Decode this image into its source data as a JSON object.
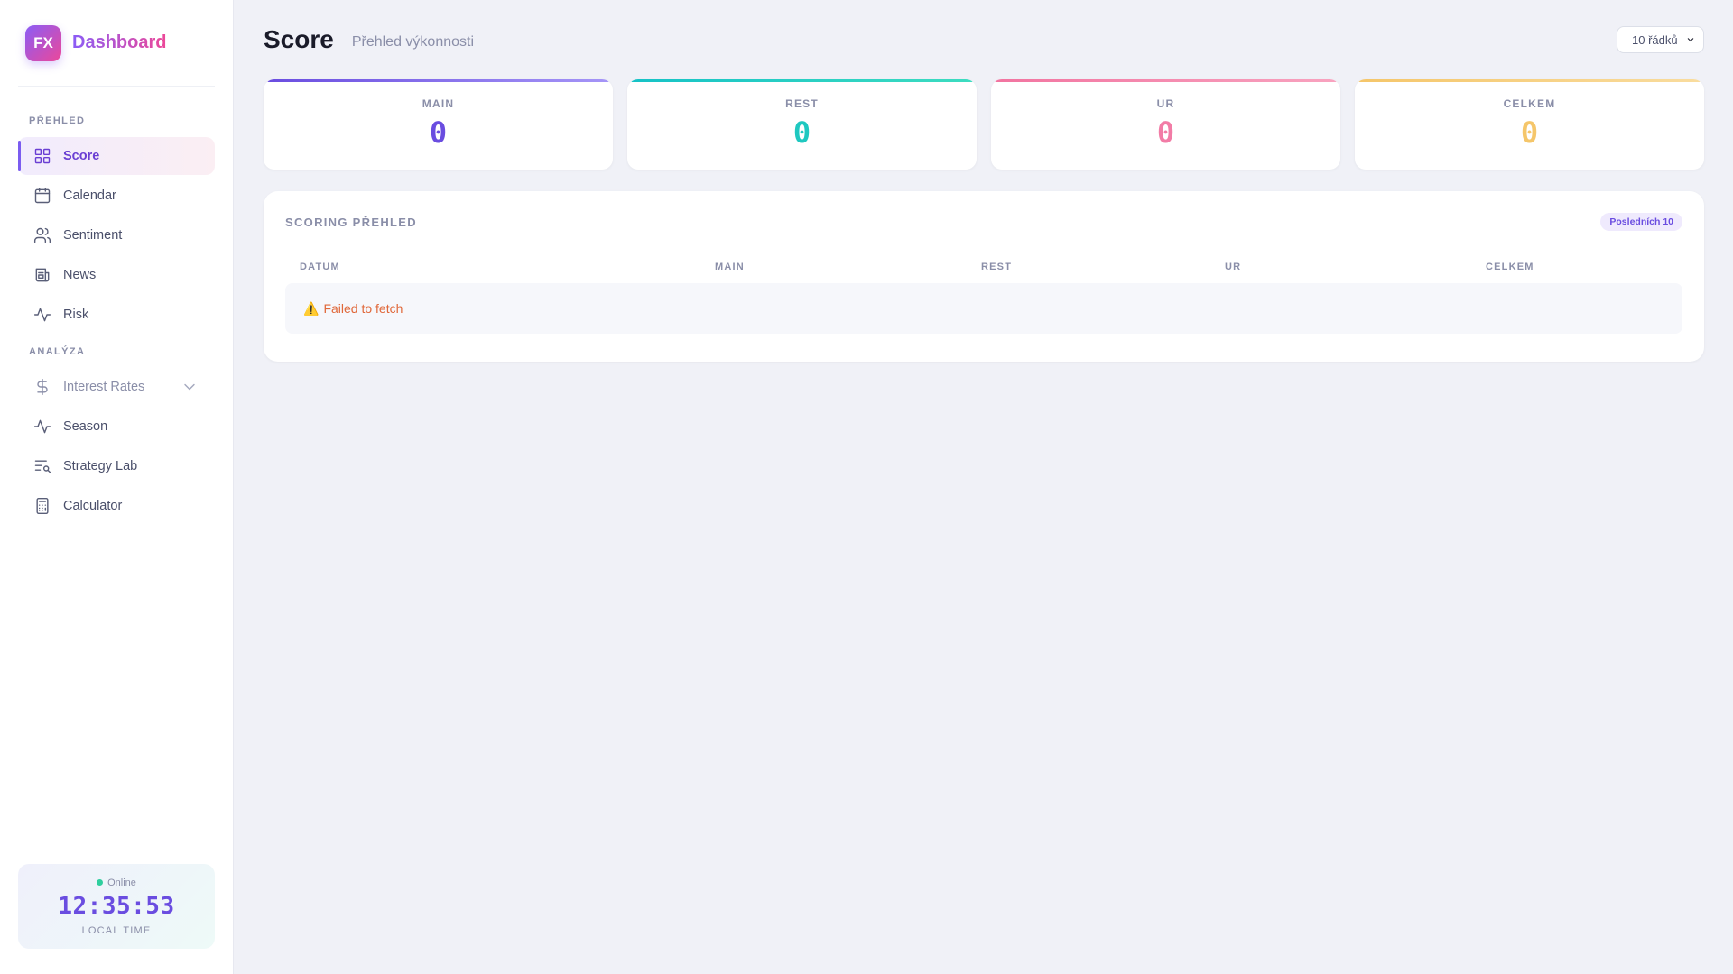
{
  "brand": {
    "logo": "FX",
    "title": "Dashboard"
  },
  "sidebar": {
    "section_overview": "PŘEHLED",
    "section_analysis": "ANALÝZA",
    "items": [
      {
        "label": "Score",
        "icon": "grid-icon",
        "active": true
      },
      {
        "label": "Calendar",
        "icon": "calendar-icon"
      },
      {
        "label": "Sentiment",
        "icon": "users-icon"
      },
      {
        "label": "News",
        "icon": "newspaper-icon"
      },
      {
        "label": "Risk",
        "icon": "activity-icon"
      }
    ],
    "analysis_items": [
      {
        "label": "Interest Rates",
        "icon": "dollar-icon",
        "expandable": true
      },
      {
        "label": "Season",
        "icon": "activity-icon"
      },
      {
        "label": "Strategy Lab",
        "icon": "list-search-icon"
      },
      {
        "label": "Calculator",
        "icon": "calculator-icon"
      }
    ]
  },
  "clock": {
    "status": "Online",
    "time": "12:35:53",
    "label": "LOCAL TIME"
  },
  "header": {
    "title": "Score",
    "subtitle": "Přehled výkonnosti",
    "rows_select": "10 řádků"
  },
  "cards": [
    {
      "label": "MAIN",
      "value": "0",
      "color": "#6a4de0",
      "bar": "#8b7cf5"
    },
    {
      "label": "REST",
      "value": "0",
      "color": "#1fc8c0",
      "bar": "#2ed6c8"
    },
    {
      "label": "UR",
      "value": "0",
      "color": "#f27ca6",
      "bar": "#f685ad"
    },
    {
      "label": "CELKEM",
      "value": "0",
      "color": "#f5c66a",
      "bar": "#f7d58c"
    }
  ],
  "panel": {
    "title": "SCORING PŘEHLED",
    "badge": "Posledních 10",
    "columns": [
      "DATUM",
      "MAIN",
      "REST",
      "UR",
      "CELKEM"
    ],
    "error_icon": "⚠️",
    "error": "Failed to fetch"
  }
}
